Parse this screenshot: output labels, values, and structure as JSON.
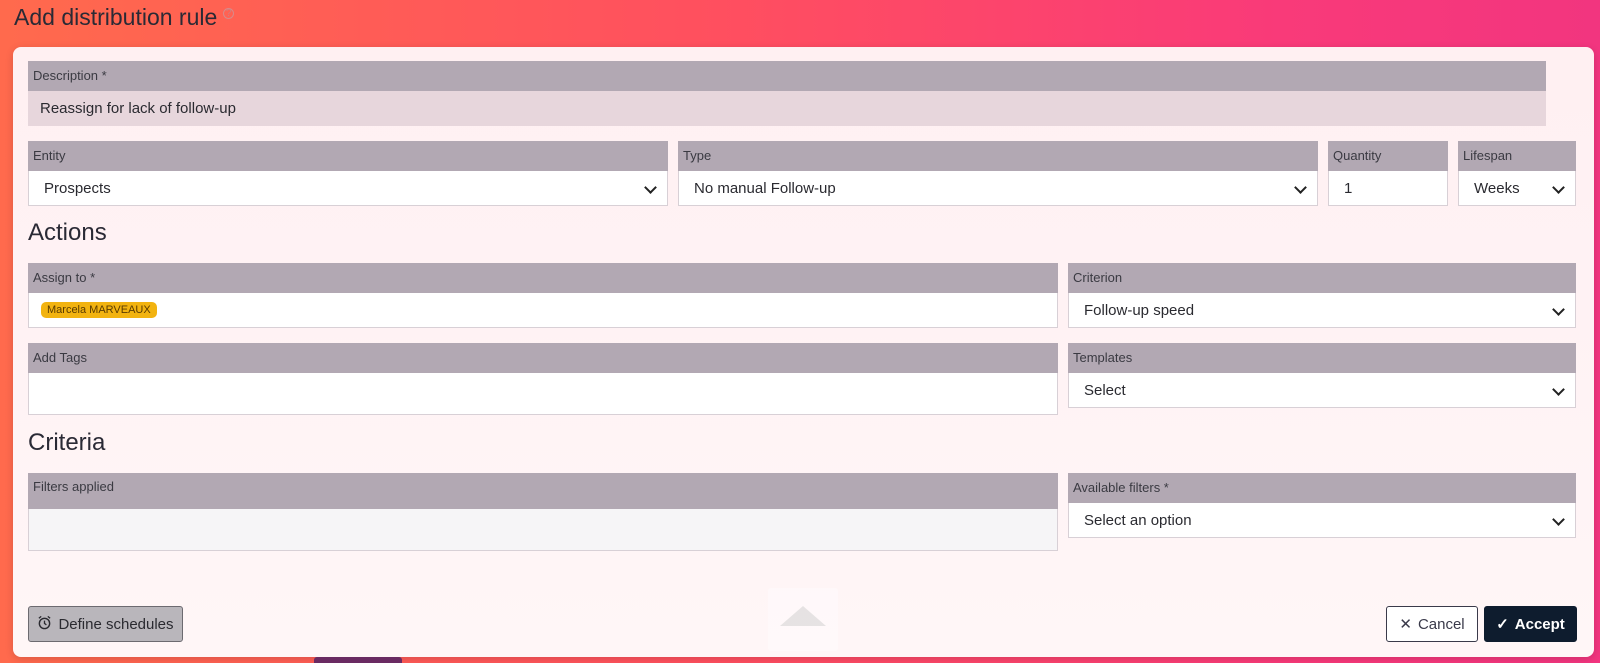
{
  "page": {
    "title": "Add distribution rule",
    "help_icon": "help-icon"
  },
  "description": {
    "label": "Description *",
    "value": "Reassign for lack of follow-up"
  },
  "entity": {
    "label": "Entity",
    "value": "Prospects"
  },
  "type": {
    "label": "Type",
    "value": "No manual Follow-up"
  },
  "quantity": {
    "label": "Quantity",
    "value": "1"
  },
  "lifespan": {
    "label": "Lifespan",
    "value": "Weeks"
  },
  "actions": {
    "title": "Actions",
    "assign_to": {
      "label": "Assign to *",
      "tags": [
        "Marcela MARVEAUX"
      ]
    },
    "criterion": {
      "label": "Criterion",
      "value": "Follow-up speed"
    },
    "add_tags": {
      "label": "Add Tags",
      "value": ""
    },
    "templates": {
      "label": "Templates",
      "value": "Select"
    }
  },
  "criteria": {
    "title": "Criteria",
    "filters_applied": {
      "label": "Filters applied"
    },
    "available_filters": {
      "label": "Available filters *",
      "value": "Select an option"
    }
  },
  "footer": {
    "schedules_label": "Define schedules",
    "schedules_icon": "alarm-clock-icon",
    "cancel_label": "Cancel",
    "cancel_icon": "close-icon",
    "accept_label": "Accept",
    "accept_icon": "check-icon"
  },
  "colors": {
    "label_bar": "#b2a8b3",
    "tag_chip": "#f2b310",
    "accept_button": "#0e1c2e"
  }
}
